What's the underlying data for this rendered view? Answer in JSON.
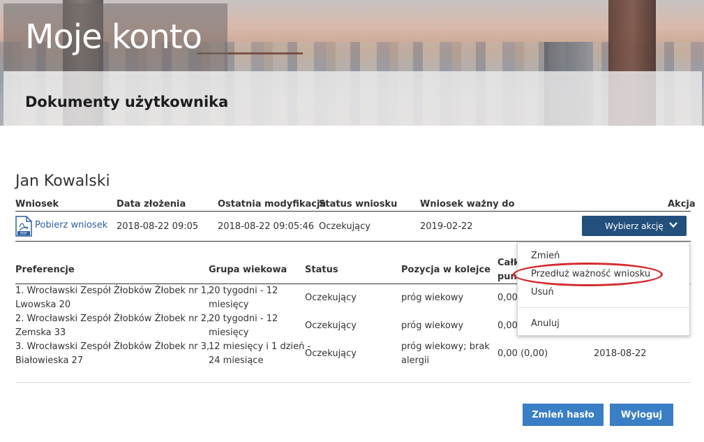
{
  "header": {
    "title": "Moje konto",
    "subtitle": "Dokumenty użytkownika"
  },
  "user": {
    "name": "Jan Kowalski"
  },
  "applications": {
    "columns": [
      "Wniosek",
      "Data złożenia",
      "Ostatnia modyfikacja",
      "Status wniosku",
      "Wniosek ważny do",
      "Akcja"
    ],
    "row": {
      "icon": "pdf-file-icon",
      "download_label": "Pobierz wniosek",
      "submitted": "2018-08-22 09:05",
      "modified": "2018-08-22 09:05:46",
      "status": "Oczekujący",
      "valid_until": "2019-02-22",
      "action_button": "Wybierz akcję"
    }
  },
  "dropdown": {
    "items": [
      "Zmień",
      "Przedłuż ważność wniosku",
      "Usuń",
      "Anuluj"
    ],
    "highlighted": "Przedłuż ważność wniosku",
    "highlight_color": "#d42a2f"
  },
  "preferences": {
    "columns": [
      "Preferencje",
      "Grupa wiekowa",
      "Status",
      "Pozycja w kolejce",
      "Całk",
      "punk"
    ],
    "rows": [
      {
        "pref_line1": "1. Wrocławski Zespół Żłobków Żłobek nr 1,",
        "pref_line2": "Lwowska 20",
        "age_line1": "20 tygodni - 12",
        "age_line2": "miesięcy",
        "status": "Oczekujący",
        "position_line1": "próg wiekowy",
        "position_line2": "",
        "points": "0,00",
        "date": ""
      },
      {
        "pref_line1": "2. Wrocławski Zespół Żłobków Żłobek nr 2,",
        "pref_line2": "Zemska 33",
        "age_line1": "20 tygodni - 12",
        "age_line2": "miesięcy",
        "status": "Oczekujący",
        "position_line1": "próg wiekowy",
        "position_line2": "",
        "points": "0,00",
        "date": ""
      },
      {
        "pref_line1": "3. Wrocławski Zespół Żłobków Żłobek nr 3,",
        "pref_line2": "Białowieska 27",
        "age_line1": "12 miesięcy i 1 dzień -",
        "age_line2": "24 miesiące",
        "status": "Oczekujący",
        "position_line1": "próg wiekowy; brak",
        "position_line2": "alergii",
        "points": "0,00 (0,00)",
        "date": "2018-08-22"
      }
    ]
  },
  "buttons": {
    "change_password": "Zmień hasło",
    "logout": "Wyloguj"
  },
  "colors": {
    "primary_dark": "#234f7c",
    "primary": "#3a7ec6",
    "link": "#2c5f9e"
  }
}
